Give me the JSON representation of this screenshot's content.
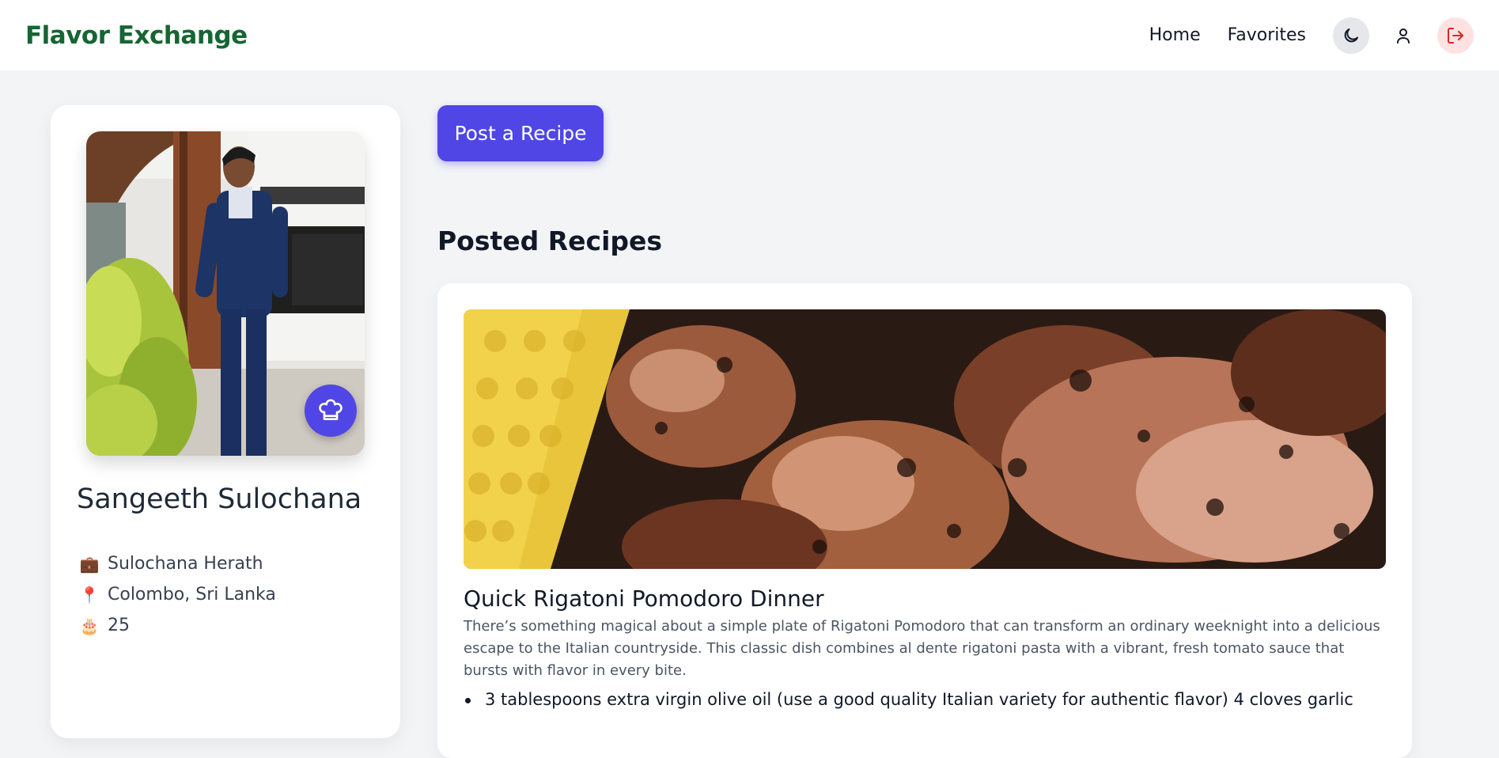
{
  "header": {
    "brand": "Flavor Exchange",
    "nav": [
      {
        "label": "Home"
      },
      {
        "label": "Favorites"
      }
    ],
    "icons": {
      "theme": "moon-icon",
      "profile": "user-icon",
      "logout": "logout-icon"
    },
    "colors": {
      "brand": "#166534",
      "logout_bg": "#fee2e2",
      "logout_icon": "#dc2626"
    }
  },
  "profile": {
    "name": "Sangeeth Sulochana",
    "details": [
      {
        "icon": "briefcase-icon",
        "glyph": "💼",
        "text": "Sulochana Herath"
      },
      {
        "icon": "location-pin-icon",
        "glyph": "📍",
        "text": "Colombo, Sri Lanka"
      },
      {
        "icon": "birthday-cake-icon",
        "glyph": "🎂",
        "text": "25"
      }
    ],
    "badge_icon": "chef-hat-icon"
  },
  "main": {
    "post_button": "Post a Recipe",
    "section_title": "Posted Recipes",
    "accent": "#4f46e5",
    "recipes": [
      {
        "title": "Quick Rigatoni Pomodoro Dinner",
        "description": "There’s something magical about a simple plate of Rigatoni Pomodoro that can transform an ordinary weeknight into a delicious escape to the Italian countryside. This classic dish combines al dente rigatoni pasta with a vibrant, fresh tomato sauce that bursts with flavor in every bite.",
        "ingredients": [
          "3 tablespoons extra virgin olive oil (use a good quality Italian variety for authentic flavor) 4 cloves garlic"
        ]
      }
    ]
  }
}
